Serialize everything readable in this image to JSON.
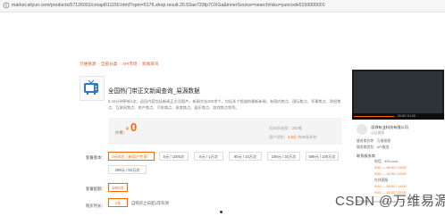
{
  "browser": {
    "url": "market.aliyun.com/products/57126001/cmapi011150.html?spm=5176.shop.result.20.53ae733fp7OXGa&innerSource=search#sku=yuncode5150000001"
  },
  "breadcrumb": [
    "万维易源",
    "全部分类",
    "API市场",
    "新闻资讯"
  ],
  "product": {
    "title": "全国热门带正文新闻查询_易源数据",
    "description": "5-10分钟更新1次，返回内容包括新闻正文及图片，新闻大站200余个，包括多个频道的最新新闻，有国内焦点、国际焦点、军事焦点、财经焦点、互联网焦点、房产焦点、汽车焦点、体育焦点、娱乐焦点、游戏焦点等等。",
    "price_label": "价格：",
    "price_currency": "¥",
    "price": "0",
    "stat1": "近30天成交：202笔",
    "stat2_prefix": "用户评价：",
    "stat2_value": "4.9分",
    "stat2_suffix": "共96条评价"
  },
  "specs": {
    "label": "套餐版本：",
    "options": [
      "0元/0次（新用户专享）",
      "5元 / 1000次",
      "8元 / 1万次",
      "90元 / 10万次",
      "199元 / 30万次",
      "599元 / 100万次",
      "299元 / 50万次"
    ],
    "selected_index": 0
  },
  "config": {
    "label": "套餐配额：",
    "value": "1000次"
  },
  "purchase": {
    "label": "购买时长：",
    "value": "1年",
    "note": "自购买之日起1年有效"
  },
  "sidebar": {
    "video_time": "00:00 / 01:26",
    "shop_name": "深圳有业科技有限公司",
    "shop_badge": "认证商家",
    "line1": "服务商名称：万维易源",
    "line2": "服务商类型：API服务",
    "service_title": "联系服务商",
    "service_phone": "电话：400-xxxx",
    "service_h1": "9:00 — 18:00 / 14:00",
    "service_h2": "9:00 — 14:00 / 22:00",
    "service_more": "在线客服",
    "service_h3": "9:00 — 18:00 / 14:00",
    "service_h4": "9:00 — 14:00 / 22:00",
    "bottom": "服务邮箱：service@showapi.com"
  },
  "watermark": "CSDN @万维易源"
}
